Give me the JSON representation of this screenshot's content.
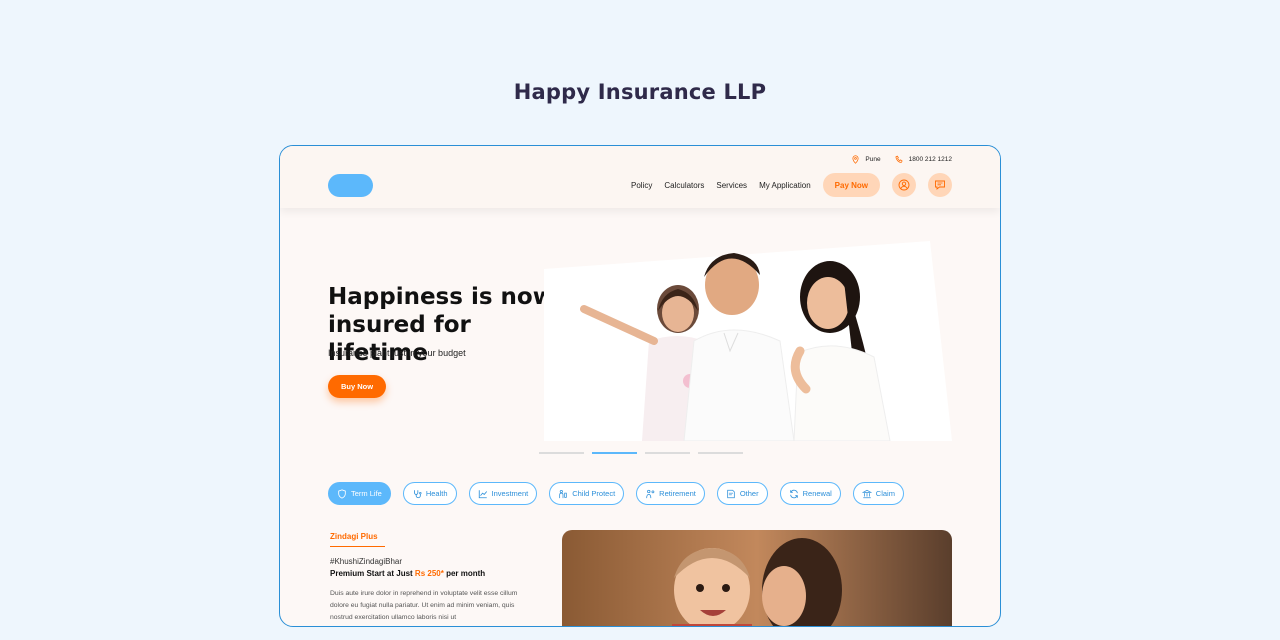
{
  "page": {
    "heading": "Happy Insurance LLP"
  },
  "utility": {
    "location": "Pune",
    "phone": "1800 212 1212"
  },
  "nav": {
    "links": [
      "Policy",
      "Calculators",
      "Services",
      "My Application"
    ],
    "pay_label": "Pay Now"
  },
  "hero": {
    "title": "Happiness is now insured for lifetime",
    "subtitle": "Insurance plant just in your budget",
    "cta": "Buy Now",
    "slides": {
      "count": 4,
      "active": 2
    }
  },
  "categories": [
    {
      "label": "Term Life",
      "icon": "shield-icon",
      "active": true
    },
    {
      "label": "Health",
      "icon": "stethoscope-icon",
      "active": false
    },
    {
      "label": "Investment",
      "icon": "chart-line-icon",
      "active": false
    },
    {
      "label": "Child Protect",
      "icon": "child-icon",
      "active": false
    },
    {
      "label": "Retirement",
      "icon": "retirement-icon",
      "active": false
    },
    {
      "label": "Other",
      "icon": "document-icon",
      "active": false
    },
    {
      "label": "Renewal",
      "icon": "refresh-icon",
      "active": false
    },
    {
      "label": "Claim",
      "icon": "bank-icon",
      "active": false
    }
  ],
  "product": {
    "tag": "Zindagi Plus",
    "hashtag": "#KhushiZindagiBhar",
    "premium_prefix": "Premium Start at Just ",
    "premium_price": "Rs 250*",
    "premium_suffix": " per month",
    "description": "Duis aute irure dolor in reprehend in voluptate velit esse cillum dolore eu fugiat nulla pariatur. Ut enim ad minim veniam, quis nostrud exercitation ullamco laboris nisi ut"
  },
  "colors": {
    "accent_orange": "#ff6a00",
    "accent_blue": "#5cb8fb",
    "peach": "#ffd6b8",
    "frame_border": "#2a8fd6"
  }
}
